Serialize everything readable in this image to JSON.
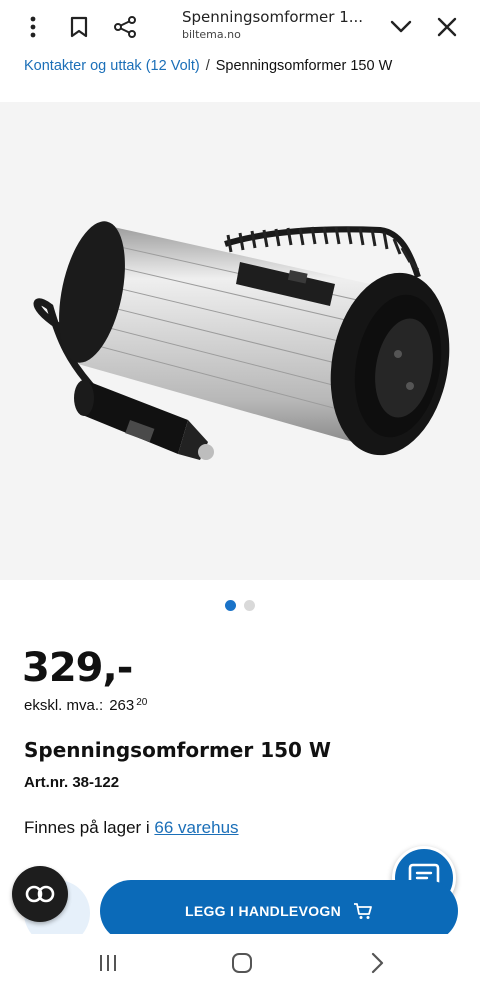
{
  "browser": {
    "tab_title": "Spenningsomformer 1...",
    "url": "biltema.no",
    "icons": [
      "more-vert-icon",
      "bookmark-icon",
      "share-icon",
      "chevron-down-icon",
      "close-icon"
    ]
  },
  "breadcrumb": {
    "parent": "Kontakter og uttak (12 Volt)",
    "separator": "/",
    "current": "Spenningsomformer 150 W"
  },
  "carousel": {
    "active_index": 0,
    "count": 2
  },
  "product": {
    "price": "329,-",
    "ex_vat_label": "ekskl. mva.:",
    "ex_vat_main": "263",
    "ex_vat_cents": "20",
    "title": "Spenningsomformer 150 W",
    "art_nr": "Art.nr. 38-122",
    "stock_prefix": "Finnes på lager i",
    "stock_link": "66 varehus"
  },
  "actions": {
    "add_to_cart": "LEGG I HANDLEVOGN"
  },
  "colors": {
    "accent": "#0b6ab8",
    "link": "#1b6fb8",
    "dot_active": "#1a73c8"
  }
}
